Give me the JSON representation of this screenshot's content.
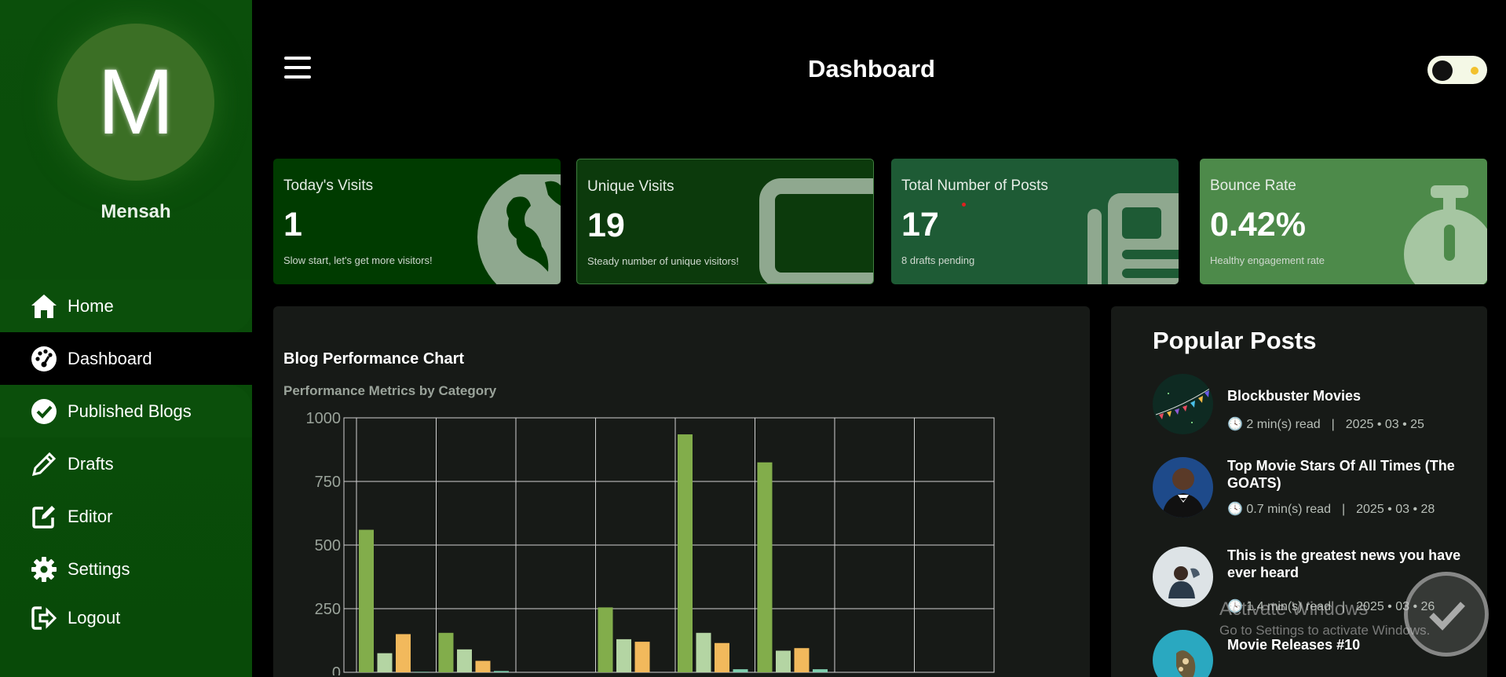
{
  "sidebar": {
    "avatar_initial": "M",
    "user_name": "Mensah",
    "items": [
      {
        "label": "Home"
      },
      {
        "label": "Dashboard"
      },
      {
        "label": "Published Blogs"
      },
      {
        "label": "Drafts"
      },
      {
        "label": "Editor"
      },
      {
        "label": "Settings"
      },
      {
        "label": "Logout"
      }
    ]
  },
  "header": {
    "title": "Dashboard"
  },
  "stats": [
    {
      "title": "Today's Visits",
      "value": "1",
      "note": "Slow start, let's get more visitors!"
    },
    {
      "title": "Unique Visits",
      "value": "19",
      "note": "Steady number of unique visitors!"
    },
    {
      "title": "Total Number of Posts",
      "value": "17",
      "note": "8 drafts pending"
    },
    {
      "title": "Bounce Rate",
      "value": "0.42%",
      "note": "Healthy engagement rate"
    }
  ],
  "chart": {
    "title": "Blog Performance Chart",
    "subtitle": "Performance Metrics by Category"
  },
  "chart_data": {
    "type": "bar",
    "title": "Blog Performance Chart",
    "subtitle": "Performance Metrics by Category",
    "ylim": [
      0,
      1000
    ],
    "yticks": [
      0,
      250,
      500,
      750,
      1000
    ],
    "categories": [
      "",
      "",
      "",
      "",
      "",
      "",
      "",
      ""
    ],
    "grid": true,
    "series": [
      {
        "values": [
          560,
          155,
          0,
          255,
          935,
          825,
          0,
          0
        ],
        "color": "#82ad4b"
      },
      {
        "values": [
          75,
          90,
          0,
          130,
          155,
          85,
          0,
          0
        ],
        "color": "#b4d5a3"
      },
      {
        "values": [
          150,
          45,
          0,
          120,
          115,
          95,
          0,
          0
        ],
        "color": "#f2b95c"
      },
      {
        "values": [
          2,
          5,
          0,
          0,
          12,
          12,
          0,
          0
        ],
        "color": "#7fcfae"
      }
    ]
  },
  "popular": {
    "title": "Popular Posts",
    "posts": [
      {
        "title": "Blockbuster Movies",
        "read": "2 min(s) read",
        "date": "2025 • 03 • 25"
      },
      {
        "title": "Top Movie Stars Of All Times (The GOATS)",
        "read": "0.7 min(s) read",
        "date": "2025 • 03 • 28"
      },
      {
        "title": "This is the greatest news you have ever heard",
        "read": "1.4 min(s) read",
        "date": "2025 • 03 • 26"
      },
      {
        "title": "Movie Releases #10",
        "read": "",
        "date": ""
      }
    ]
  },
  "watermark": {
    "line1": "Activate Windows",
    "line2": "Go to Settings to activate Windows."
  },
  "colors": {
    "sidebar": "#0b4f0b",
    "card1": "#003b00",
    "card2": "#0c3a0c",
    "card3": "#1e5b35",
    "card4": "#4d8a4a",
    "panel": "#171a17"
  }
}
